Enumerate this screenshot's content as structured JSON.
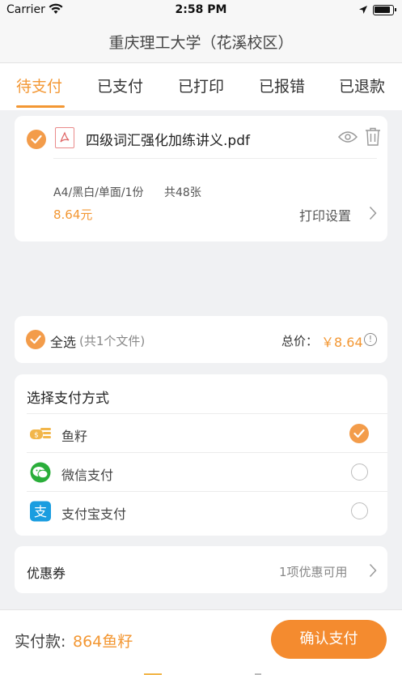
{
  "status_bar": {
    "carrier": "Carrier",
    "time": "2:58 PM"
  },
  "nav": {
    "title": "重庆理工大学（花溪校区）"
  },
  "tabs": [
    {
      "label": "待支付",
      "active": true
    },
    {
      "label": "已支付"
    },
    {
      "label": "已打印"
    },
    {
      "label": "已报错"
    },
    {
      "label": "已退款"
    }
  ],
  "file": {
    "name": "四级词汇强化加练讲义.pdf",
    "spec": "A4/黑白/单面/1份",
    "pages": "共48张",
    "price": "8.64元",
    "print_settings": "打印设置",
    "icon": "pdf-icon"
  },
  "summary": {
    "select_all": "全选",
    "count": "(共1个文件)",
    "total_label": "总价：",
    "total_value": "￥8.64",
    "info_icon": "!"
  },
  "payment": {
    "header": "选择支付方式",
    "methods": [
      {
        "label": "鱼籽",
        "icon": "coins-icon",
        "selected": true
      },
      {
        "label": "微信支付",
        "icon": "wechat-icon",
        "selected": false
      },
      {
        "label": "支付宝支付",
        "icon": "alipay-icon",
        "selected": false
      }
    ]
  },
  "coupon": {
    "label": "优惠券",
    "hint": "1项优惠可用"
  },
  "footer": {
    "amount_label": "实付款:",
    "amount": "864鱼籽",
    "confirm": "确认支付"
  },
  "colors": {
    "accent": "#f39733",
    "wechat": "#2aae3a",
    "alipay": "#1a9de0"
  }
}
